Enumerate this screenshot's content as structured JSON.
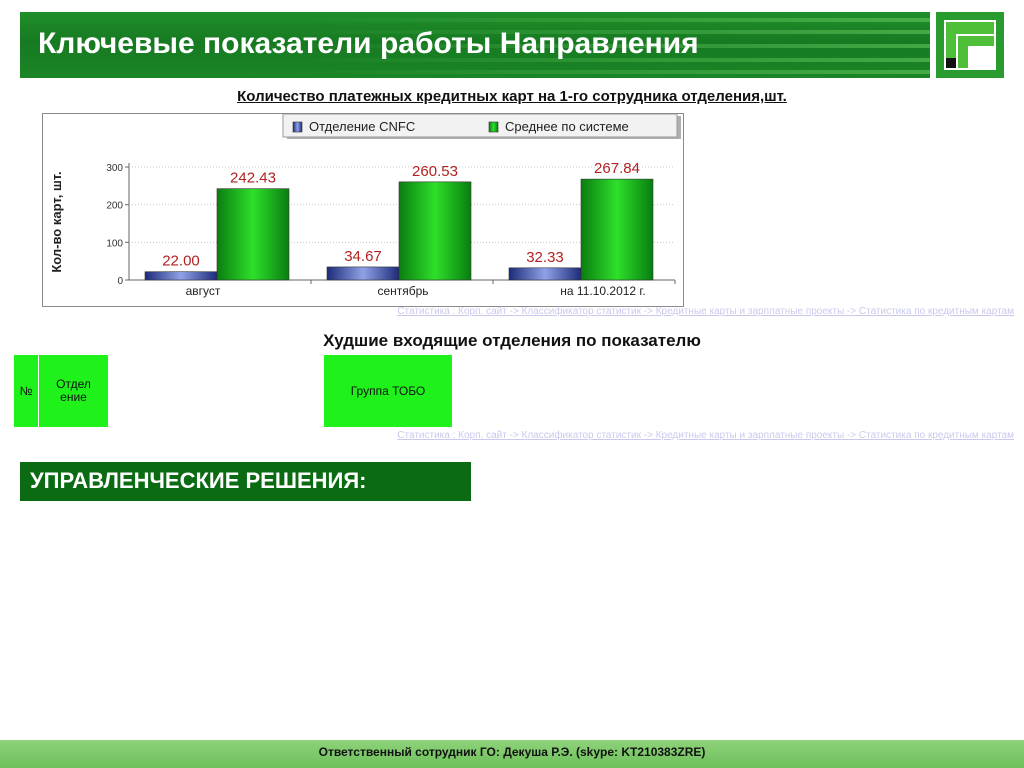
{
  "header": {
    "title": "Ключевые показатели работы Направления"
  },
  "chart_section": {
    "title": "Количество платежных кредитных карт на 1-го сотрудника отделения,шт.",
    "source_link": "Статистика : Корп. сайт -> Классификатор статистик -> Кредитные карты и зарплатные проекты -> Статистика по кредитным картам"
  },
  "chart_data": {
    "type": "bar",
    "categories": [
      "август",
      "сентябрь",
      "на 11.10.2012 г."
    ],
    "series": [
      {
        "name": "Отделение CNFC",
        "values": [
          22.0,
          34.67,
          32.33
        ],
        "labels": [
          "22.00",
          "34.67",
          "32.33"
        ],
        "color": "#2a3a9a"
      },
      {
        "name": "Среднее по системе",
        "values": [
          242.43,
          260.53,
          267.84
        ],
        "labels": [
          "242.43",
          "260.53",
          "267.84"
        ],
        "color": "#14b01a"
      }
    ],
    "title": "",
    "xlabel": "",
    "ylabel": "Кол-во карт, шт.",
    "ylim": [
      0,
      300
    ],
    "yticks": [
      "0",
      "100",
      "200",
      "300"
    ],
    "grid": true,
    "legend_position": "top"
  },
  "worst_section": {
    "title": "Худшие входящие отделения по показателю",
    "columns": {
      "number": "№",
      "branch": "Отдел ение",
      "group": "Группа ТОБО"
    },
    "source_link": "Статистика : Корп. сайт -> Классификатор статистик -> Кредитные карты и зарплатные проекты -> Статистика по кредитным картам"
  },
  "decisions": {
    "label": "УПРАВЛЕНЧЕСКИЕ РЕШЕНИЯ:"
  },
  "footer": {
    "text": "Ответственный сотрудник ГО: Декуша Р.Э. (skype: KT210383ZRE)"
  },
  "colors": {
    "header_green": "#177a22",
    "cell_green": "#1ef21a",
    "decisions_green": "#0a6b12",
    "footer_green": "#6cc05a"
  }
}
